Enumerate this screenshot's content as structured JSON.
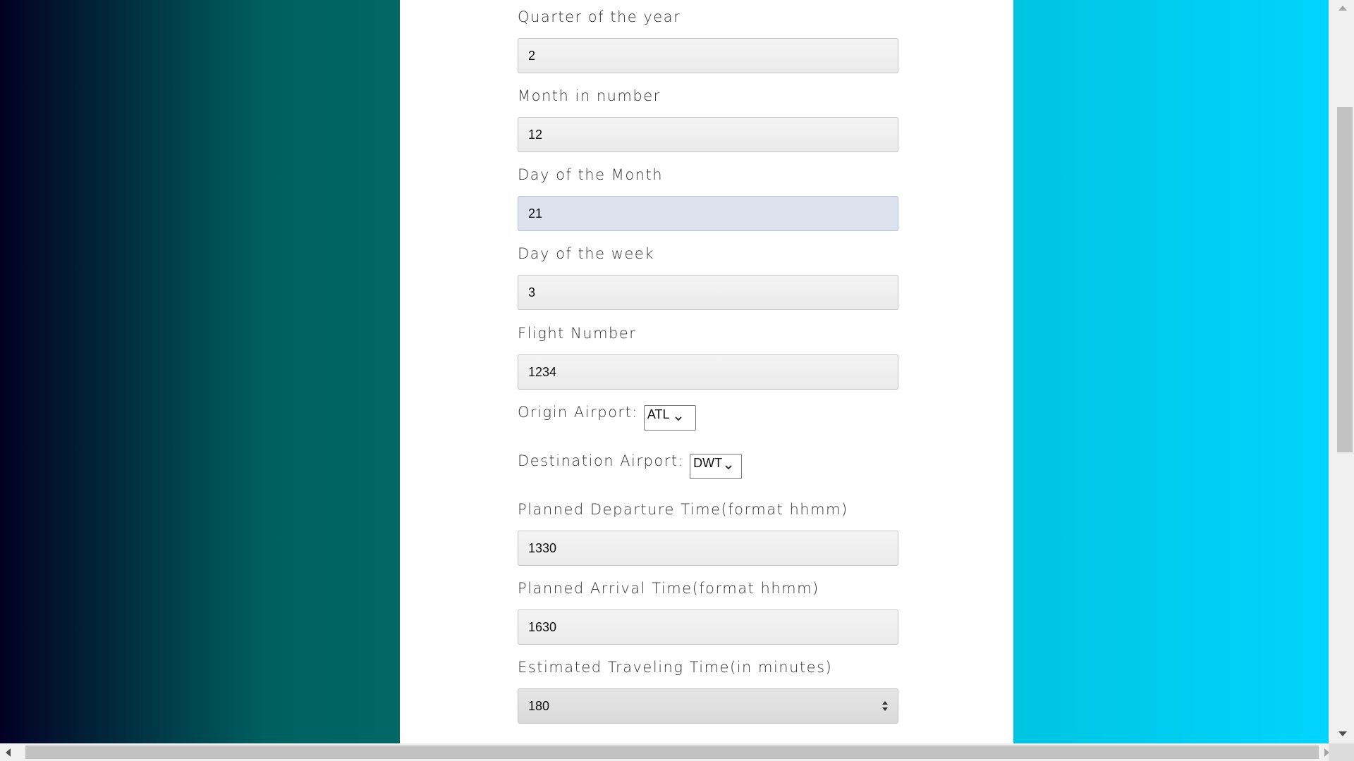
{
  "form": {
    "quarter": {
      "label": "Quarter of the year",
      "value": "2"
    },
    "month": {
      "label": "Month in number",
      "value": "12"
    },
    "day_of_month": {
      "label": "Day of the Month",
      "value": "21"
    },
    "day_of_week": {
      "label": "Day of the week",
      "value": "3"
    },
    "flight_number": {
      "label": "Flight Number",
      "value": "1234"
    },
    "origin": {
      "label": "Origin Airport:",
      "selected": "ATL"
    },
    "destination": {
      "label": "Destination Airport:",
      "selected": "DWT"
    },
    "departure": {
      "label": "Planned Departure Time(format hhmm)",
      "value": "1330"
    },
    "arrival": {
      "label": "Planned Arrival Time(format hhmm)",
      "value": "1630"
    },
    "travel_time": {
      "label": "Estimated Traveling Time(in minutes)",
      "value": "180"
    }
  },
  "icons": {
    "select_chevron": "chevron-down-icon",
    "number_spinner": "spinner-arrows-icon"
  },
  "colors": {
    "panel_bg": "#ffffff",
    "gradient_left": "#020024",
    "gradient_mid": "#006a6a",
    "gradient_right": "#00d4ff",
    "focused_input": "#dce3ee"
  }
}
